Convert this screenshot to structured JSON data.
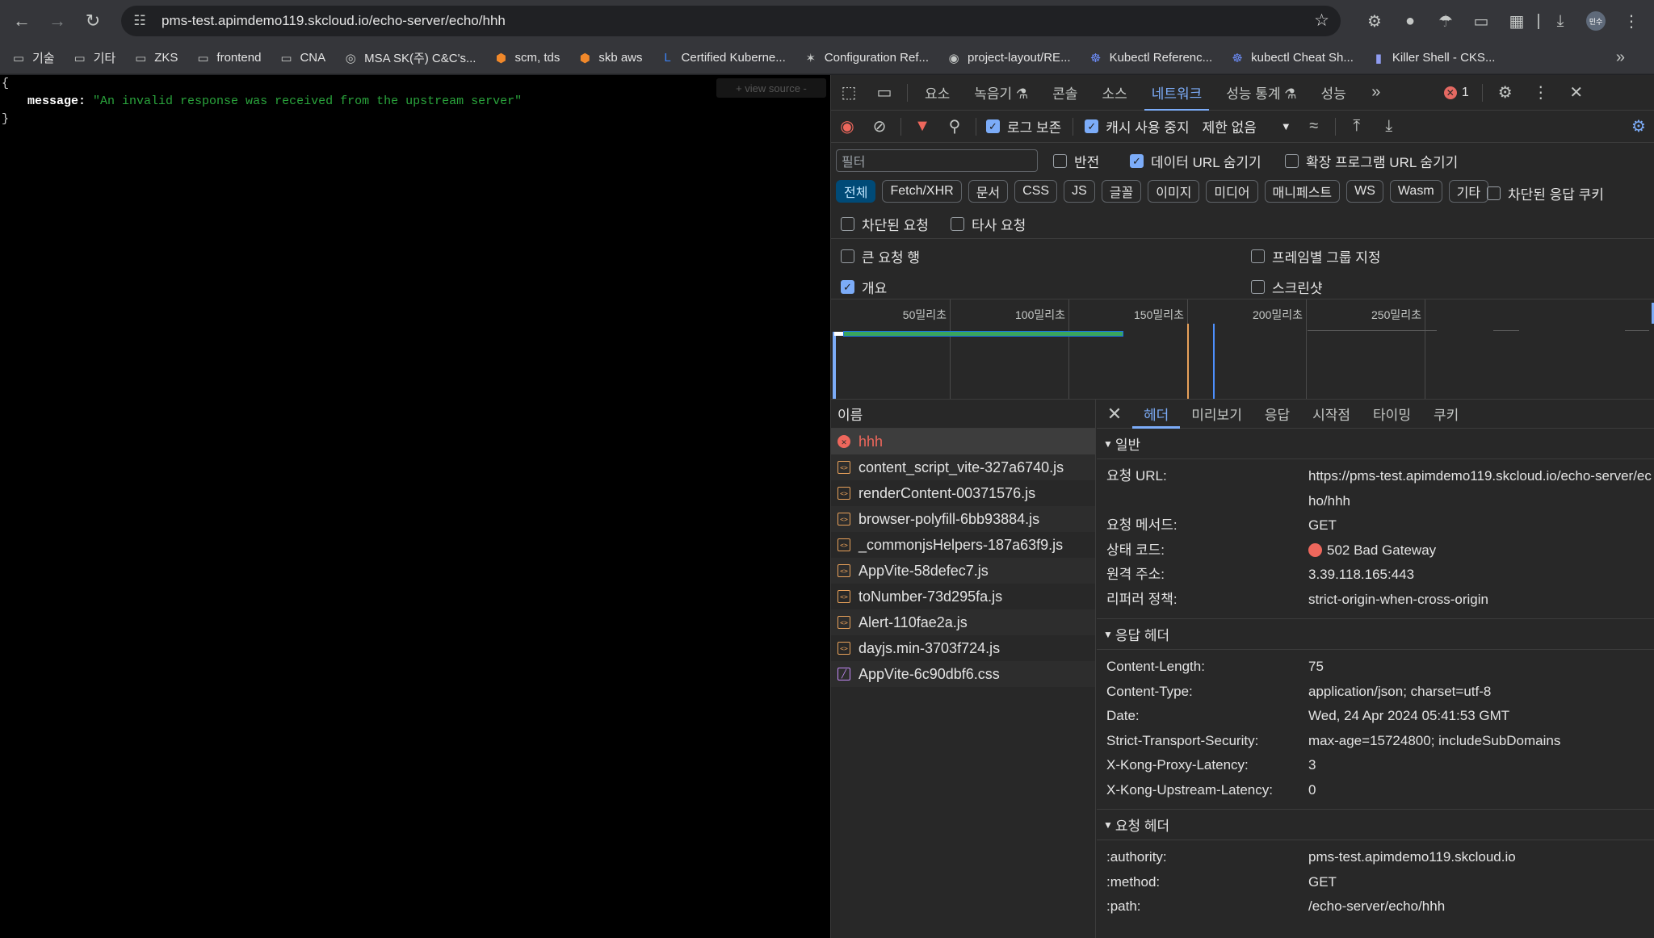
{
  "browser": {
    "url": "pms-test.apimdemo119.skcloud.io/echo-server/echo/hhh",
    "profile_initials": "민수"
  },
  "bookmarks": [
    {
      "label": "기술",
      "icon": "folder-icon"
    },
    {
      "label": "기타",
      "icon": "folder-icon"
    },
    {
      "label": "ZKS",
      "icon": "folder-icon"
    },
    {
      "label": "frontend",
      "icon": "folder-icon"
    },
    {
      "label": "CNA",
      "icon": "folder-icon"
    },
    {
      "label": "MSA SK(주) C&C's...",
      "icon": "globe-icon"
    },
    {
      "label": "scm, tds",
      "icon": "aws-cube-icon"
    },
    {
      "label": "skb aws",
      "icon": "aws-cube-icon"
    },
    {
      "label": "Certified Kuberne...",
      "icon": "linux-foundation-icon"
    },
    {
      "label": "Configuration Ref...",
      "icon": "kong-icon"
    },
    {
      "label": "project-layout/RE...",
      "icon": "github-icon"
    },
    {
      "label": "Kubectl Referenc...",
      "icon": "kubernetes-icon"
    },
    {
      "label": "kubectl Cheat Sh...",
      "icon": "kubernetes-icon"
    },
    {
      "label": "Killer Shell - CKS...",
      "icon": "killer-shell-icon"
    }
  ],
  "page": {
    "open_brace": "{",
    "close_brace": "}",
    "key": "message:",
    "value": "\"An invalid response was received from the upstream server\"",
    "view_source": "+ view source -"
  },
  "devtools": {
    "tabs": [
      "요소",
      "녹음기 ⚗",
      "콘솔",
      "소스",
      "네트워크",
      "성능 통계 ⚗",
      "성능"
    ],
    "active_tab": "네트워크",
    "error_count": "1",
    "toolbar": {
      "preserve_log": "로그 보존",
      "disable_cache": "캐시 사용 중지",
      "throttling": "제한 없음"
    },
    "filter": {
      "placeholder": "필터",
      "invert": "반전",
      "hide_data_urls": "데이터 URL 숨기기",
      "hide_extension_urls": "확장 프로그램 URL 숨기기",
      "types": [
        "전체",
        "Fetch/XHR",
        "문서",
        "CSS",
        "JS",
        "글꼴",
        "이미지",
        "미디어",
        "매니페스트",
        "WS",
        "Wasm",
        "기타"
      ],
      "blocked_cookies": "차단된 응답 쿠키",
      "blocked_requests": "차단된 요청",
      "third_party": "타사 요청",
      "big_rows": "큰 요청 행",
      "group_by_frame": "프레임별 그룹 지정",
      "overview": "개요",
      "screenshots": "스크린샷"
    },
    "timeline_ticks": [
      "50밀리초",
      "100밀리초",
      "150밀리초",
      "200밀리초",
      "250밀리초"
    ],
    "name_header": "이름",
    "requests": [
      {
        "name": "hhh",
        "type": "error"
      },
      {
        "name": "content_script_vite-327a6740.js",
        "type": "script"
      },
      {
        "name": "renderContent-00371576.js",
        "type": "script"
      },
      {
        "name": "browser-polyfill-6bb93884.js",
        "type": "script"
      },
      {
        "name": "_commonjsHelpers-187a63f9.js",
        "type": "script"
      },
      {
        "name": "AppVite-58defec7.js",
        "type": "script"
      },
      {
        "name": "toNumber-73d295fa.js",
        "type": "script"
      },
      {
        "name": "Alert-110fae2a.js",
        "type": "script"
      },
      {
        "name": "dayjs.min-3703f724.js",
        "type": "script"
      },
      {
        "name": "AppVite-6c90dbf6.css",
        "type": "css"
      }
    ],
    "detail_tabs": [
      "헤더",
      "미리보기",
      "응답",
      "시작점",
      "타이밍",
      "쿠키"
    ],
    "general": {
      "title": "일반",
      "rows": [
        {
          "k": "요청 URL:",
          "v": "https://pms-test.apimdemo119.skcloud.io/echo-server/echo/hhh"
        },
        {
          "k": "요청 메서드:",
          "v": "GET"
        },
        {
          "k": "상태 코드:",
          "v": "502 Bad Gateway"
        },
        {
          "k": "원격 주소:",
          "v": "3.39.118.165:443"
        },
        {
          "k": "리퍼러 정책:",
          "v": "strict-origin-when-cross-origin"
        }
      ]
    },
    "response_headers": {
      "title": "응답 헤더",
      "rows": [
        {
          "k": "Content-Length:",
          "v": "75"
        },
        {
          "k": "Content-Type:",
          "v": "application/json; charset=utf-8"
        },
        {
          "k": "Date:",
          "v": "Wed, 24 Apr 2024 05:41:53 GMT"
        },
        {
          "k": "Strict-Transport-Security:",
          "v": "max-age=15724800; includeSubDomains"
        },
        {
          "k": "X-Kong-Proxy-Latency:",
          "v": "3"
        },
        {
          "k": "X-Kong-Upstream-Latency:",
          "v": "0"
        }
      ]
    },
    "request_headers": {
      "title": "요청 헤더",
      "rows": [
        {
          "k": ":authority:",
          "v": "pms-test.apimdemo119.skcloud.io"
        },
        {
          "k": ":method:",
          "v": "GET"
        },
        {
          "k": ":path:",
          "v": "/echo-server/echo/hhh"
        }
      ]
    },
    "colors": {
      "accent": "#7cacf8",
      "error": "#ee675c",
      "json_string": "#2aa43c"
    }
  }
}
